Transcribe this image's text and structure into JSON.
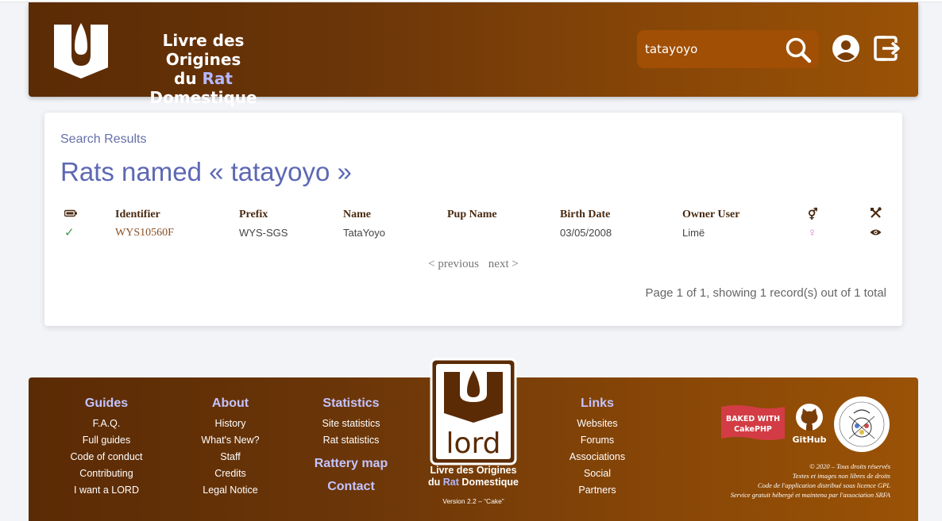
{
  "header": {
    "brand_line1": "Livre des Origines",
    "brand_du": "du ",
    "brand_rat": "Rat",
    "brand_rest": " Domestique",
    "search_value": "tatayoyo"
  },
  "content": {
    "breadcrumb": "Search Results",
    "title": "Rats named « tatayoyo »",
    "columns": [
      "Identifier",
      "Prefix",
      "Name",
      "Pup Name",
      "Birth Date",
      "Owner User"
    ],
    "rows": [
      {
        "status": "✓",
        "identifier": "WYS10560F",
        "prefix": "WYS-SGS",
        "name": "TataYoyo",
        "pup_name": "",
        "birth_date": "03/05/2008",
        "owner": "Limë",
        "sex": "♀"
      }
    ],
    "sex_header": "⚥",
    "pager_prev": "< previous",
    "pager_next": "next >",
    "page_info": "Page 1 of 1, showing 1 record(s) out of 1 total"
  },
  "footer": {
    "guides": {
      "title": "Guides",
      "links": [
        "F.A.Q.",
        "Full guides",
        "Code of conduct",
        "Contributing",
        "I want a LORD"
      ]
    },
    "about": {
      "title": "About",
      "links": [
        "History",
        "What's New?",
        "Staff",
        "Credits",
        "Legal Notice"
      ]
    },
    "statistics": {
      "title": "Statistics",
      "links": [
        "Site statistics",
        "Rat statistics"
      ]
    },
    "rattery_map": "Rattery map",
    "contact": "Contact",
    "lord_text": "lord",
    "lord_brand_line1": "Livre des Origines",
    "lord_brand_du": "du ",
    "lord_brand_rat": "Rat",
    "lord_brand_rest": " Domestique",
    "version": "Version 2.2 – “Cake”",
    "links": {
      "title": "Links",
      "links": [
        "Websites",
        "Forums",
        "Associations",
        "Social",
        "Partners"
      ]
    },
    "cake_line1": "BAKED WITH",
    "cake_line2": "CakePHP",
    "github": "GitHub",
    "legal": [
      "© 2020 – Tous droits réservés",
      "Textes et images non libres de droits",
      "Code de l'application distribué sous licence GPL",
      "Service gratuit hébergé et maintenu par l'association SRFA"
    ]
  },
  "colors": {
    "header_start": "#5b2b05",
    "header_end": "#9a5206",
    "search_bg": "#a04f05",
    "accent_blue": "#5d68b4",
    "link_lilac": "#c4c4ff"
  }
}
